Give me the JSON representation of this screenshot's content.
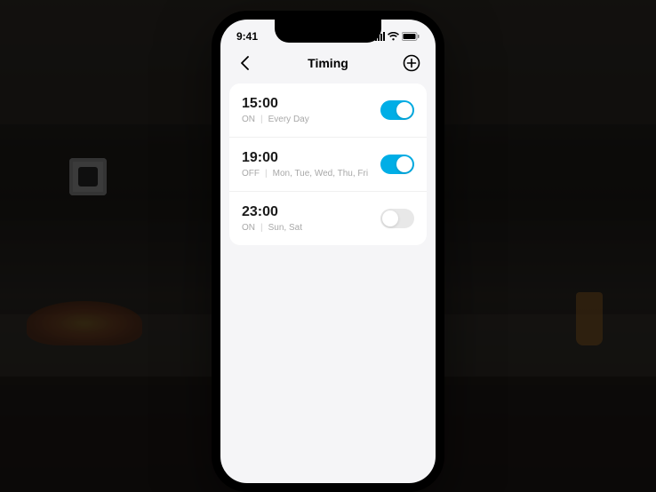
{
  "status_bar": {
    "time": "9:41"
  },
  "nav": {
    "title": "Timing"
  },
  "colors": {
    "accent": "#00aee6",
    "toggle_off": "#e8e8e8"
  },
  "timers": [
    {
      "time": "15:00",
      "action": "ON",
      "repeat": "Every Day",
      "enabled": true
    },
    {
      "time": "19:00",
      "action": "OFF",
      "repeat": "Mon, Tue, Wed, Thu, Fri",
      "enabled": true
    },
    {
      "time": "23:00",
      "action": "ON",
      "repeat": "Sun, Sat",
      "enabled": false
    }
  ]
}
